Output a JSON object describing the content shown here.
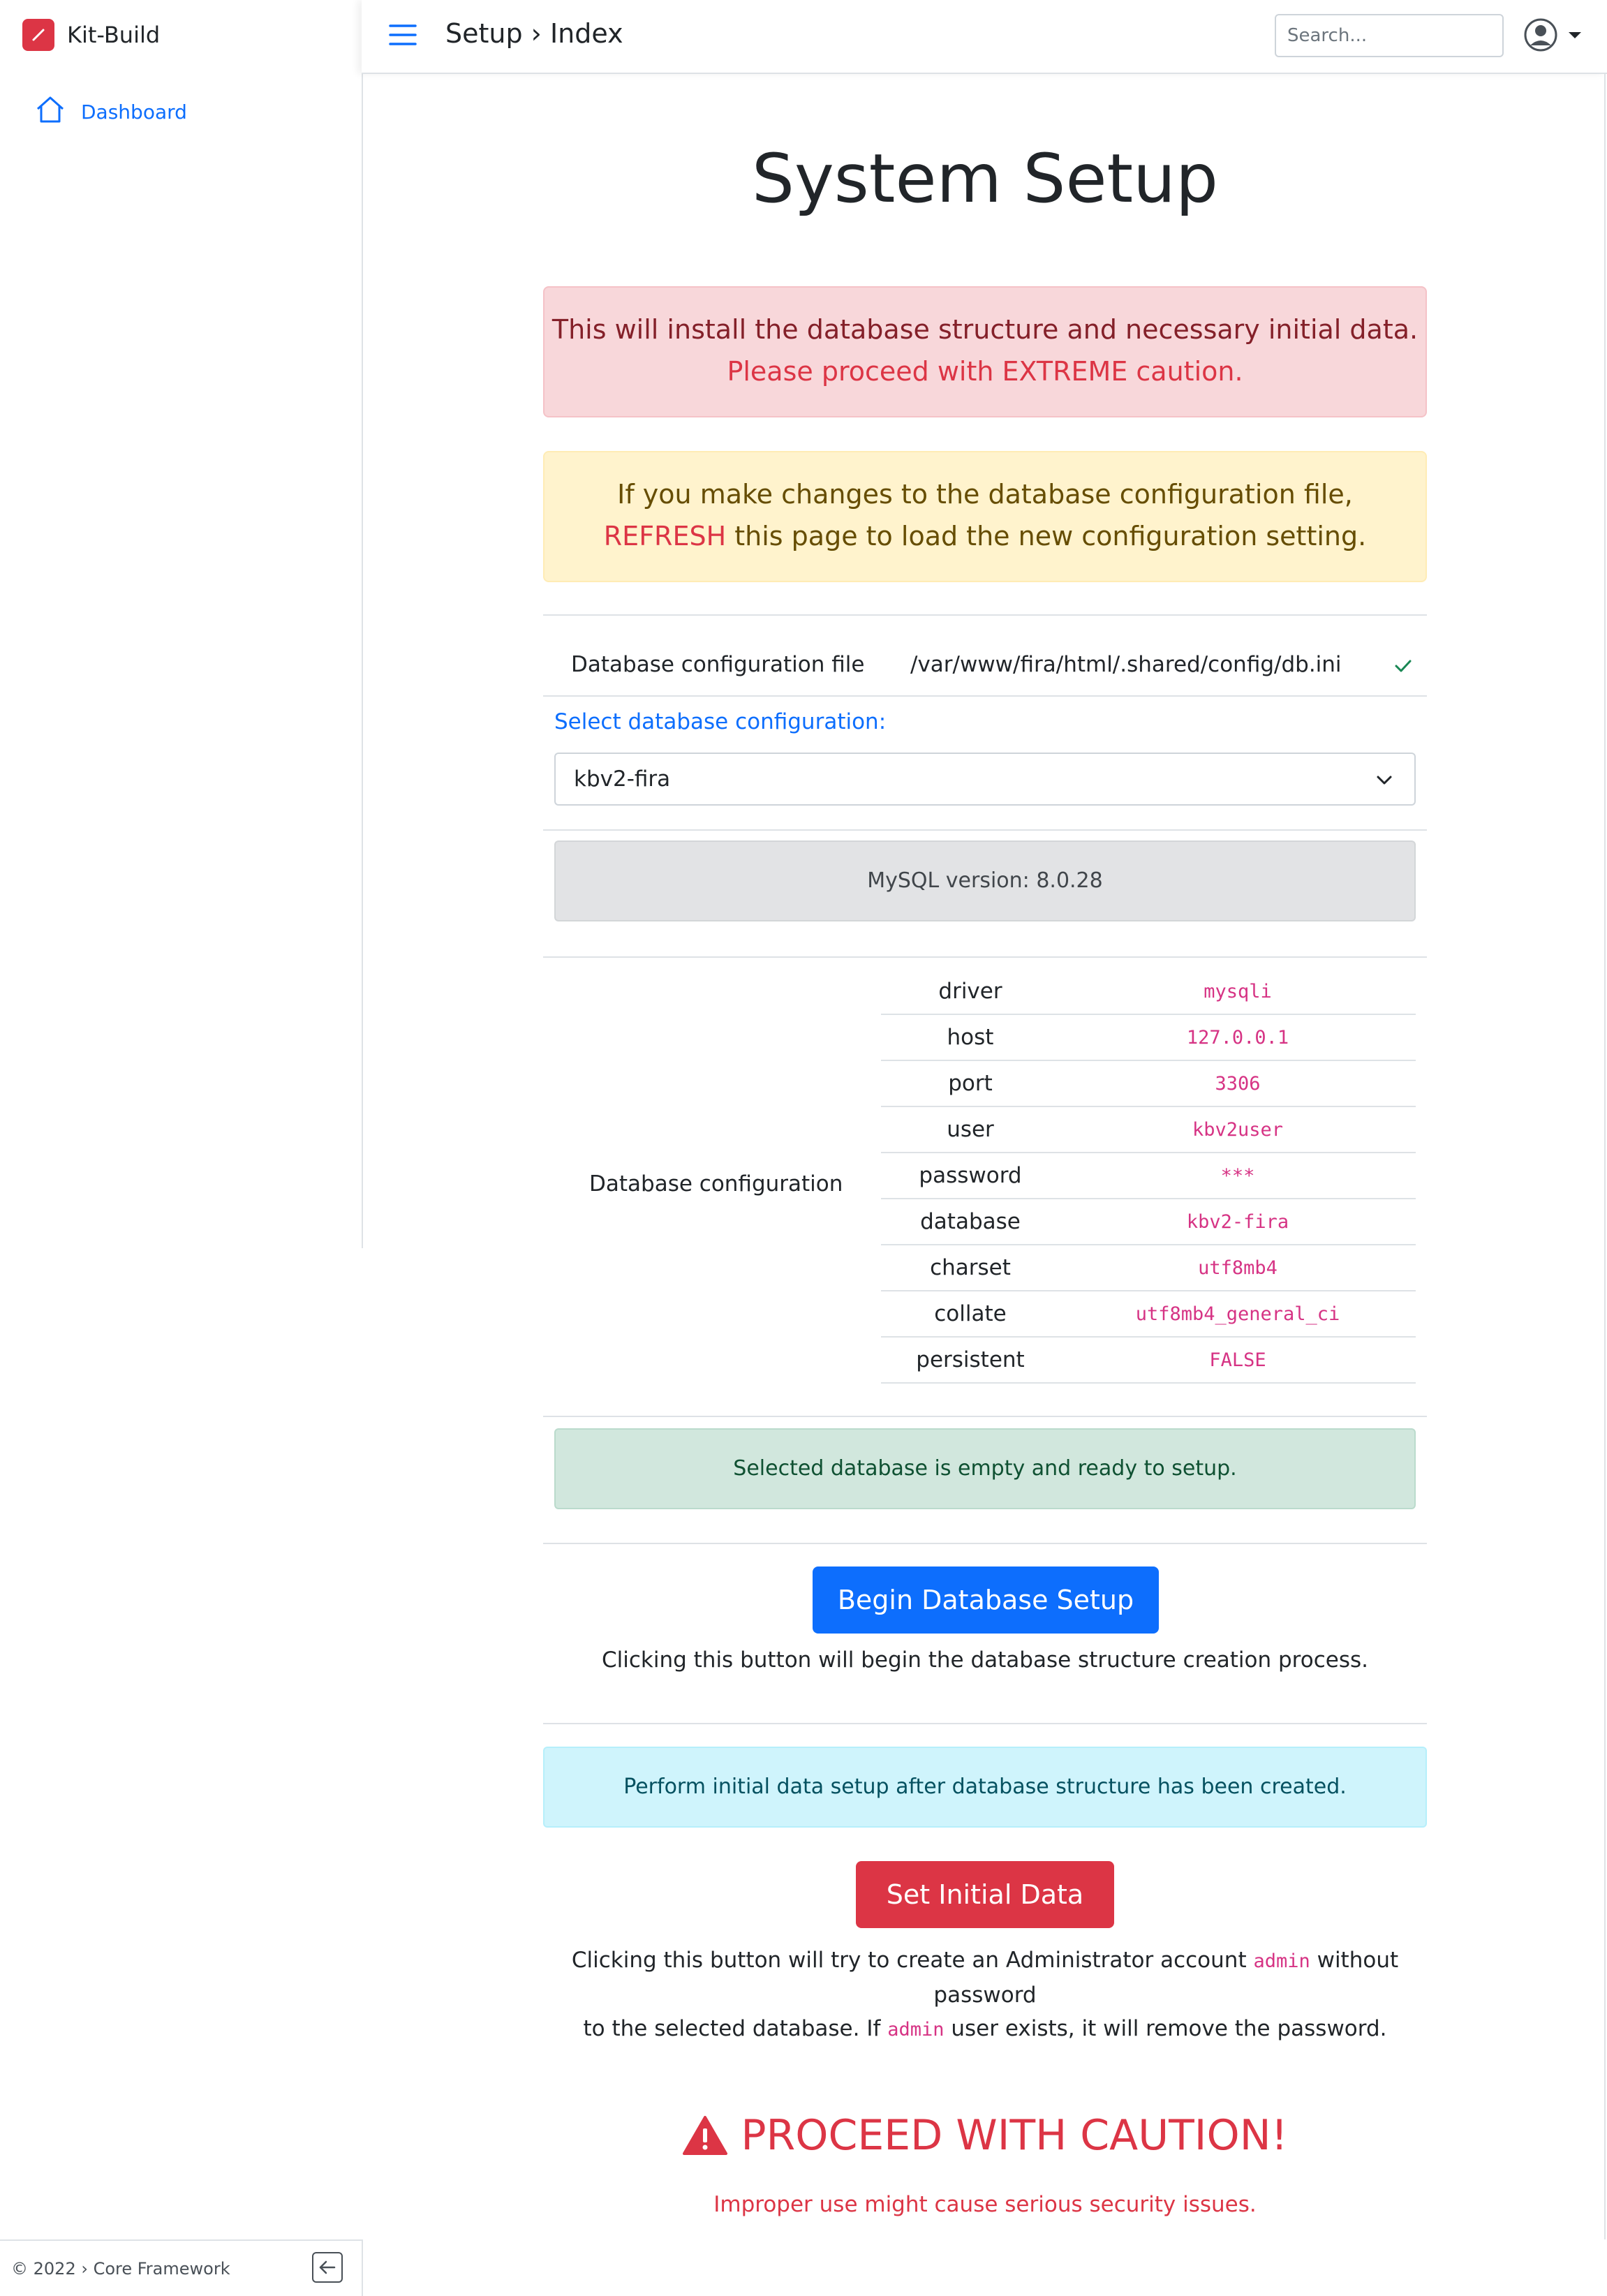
{
  "app": {
    "name": "Kit-Build",
    "breadcrumb": "Setup › Index",
    "search_placeholder": "Search...",
    "footer": "© 2022 › Core Framework"
  },
  "sidebar": {
    "items": [
      {
        "label": "Dashboard",
        "icon": "home-icon"
      }
    ]
  },
  "page": {
    "title": "System Setup",
    "danger_line1": "This will install the database structure and necessary initial data.",
    "danger_line2": "Please proceed with EXTREME caution.",
    "warning_line1": "If you make changes to the database configuration file,",
    "warning_refresh": "REFRESH",
    "warning_line2_rest": " this page to load the new configuration setting.",
    "config_file_label": "Database configuration file",
    "config_file_path": "/var/www/fira/html/.shared/config/db.ini",
    "select_label": "Select database configuration:",
    "select_value": "kbv2-fira",
    "mysql_version": "MySQL version: 8.0.28",
    "db_config_label": "Database configuration",
    "db_config": [
      {
        "key": "driver",
        "value": "mysqli"
      },
      {
        "key": "host",
        "value": "127.0.0.1"
      },
      {
        "key": "port",
        "value": "3306"
      },
      {
        "key": "user",
        "value": "kbv2user"
      },
      {
        "key": "password",
        "value": "***"
      },
      {
        "key": "database",
        "value": "kbv2-fira"
      },
      {
        "key": "charset",
        "value": "utf8mb4"
      },
      {
        "key": "collate",
        "value": "utf8mb4_general_ci"
      },
      {
        "key": "persistent",
        "value": "FALSE"
      }
    ],
    "success_message": "Selected database is empty and ready to setup.",
    "begin_button": "Begin Database Setup",
    "begin_help": "Clicking this button will begin the database structure creation process.",
    "info_message": "Perform initial data setup after database structure has been created.",
    "initial_button": "Set Initial Data",
    "initial_help_1": "Clicking this button will try to create an Administrator account ",
    "initial_help_code1": "admin",
    "initial_help_2": " without password",
    "initial_help_3": "to the selected database. If ",
    "initial_help_code2": "admin",
    "initial_help_4": " user exists, it will remove the password.",
    "caution_title": "PROCEED WITH CAUTION!",
    "caution_sub": "Improper use might cause serious security issues."
  },
  "colors": {
    "primary": "#0d6efd",
    "danger": "#dc3545",
    "success_bg": "#d1e7dd",
    "info_bg": "#cff4fc",
    "warning_bg": "#fff3cd",
    "danger_bg": "#f8d7da"
  }
}
